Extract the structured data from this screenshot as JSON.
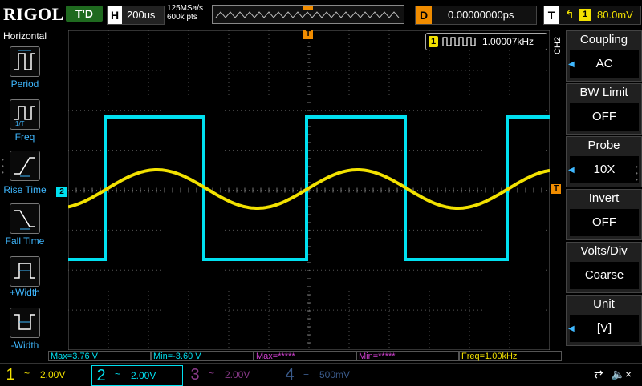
{
  "top": {
    "brand": "RIGOL",
    "run_status": "T'D",
    "timebase_tag": "H",
    "timebase": "200us",
    "sample_rate": "125MSa/s",
    "mem_depth": "600k pts",
    "delay_tag": "D",
    "delay": "0.00000000ps",
    "trigger_tag": "T",
    "trigger_channel": "1",
    "trigger_level": "80.0mV"
  },
  "left_menu": {
    "title": "Horizontal",
    "items": [
      {
        "label": "Period",
        "icon": "period-icon"
      },
      {
        "label": "Freq",
        "icon": "freq-icon"
      },
      {
        "label": "Rise Time",
        "icon": "rise-time-icon"
      },
      {
        "label": "Fall Time",
        "icon": "fall-time-icon"
      },
      {
        "label": "+Width",
        "icon": "pos-width-icon"
      },
      {
        "label": "-Width",
        "icon": "neg-width-icon"
      }
    ]
  },
  "screen": {
    "freq_counter_channel": "1",
    "freq_counter": "1.00007kHz",
    "ch2_marker": "2",
    "trig_marker": "T",
    "t_marker": "T"
  },
  "right_menu": {
    "channel_label": "CH2",
    "items": [
      {
        "title": "Coupling",
        "value": "AC",
        "arrow": true
      },
      {
        "title": "BW Limit",
        "value": "OFF",
        "arrow": false
      },
      {
        "title": "Probe",
        "value": "10X",
        "arrow": true
      },
      {
        "title": "Invert",
        "value": "OFF",
        "arrow": false
      },
      {
        "title": "Volts/Div",
        "value": "Coarse",
        "arrow": false
      },
      {
        "title": "Unit",
        "value": "[V]",
        "arrow": true
      }
    ]
  },
  "measurements": [
    {
      "text": "Max=3.76 V",
      "color": "#00e0f0"
    },
    {
      "text": "Min=-3.60 V",
      "color": "#00e0f0"
    },
    {
      "text": "Max=*****",
      "color": "#d040d0"
    },
    {
      "text": "Min=*****",
      "color": "#d040d0"
    },
    {
      "text": "Freq=1.00kHz",
      "color": "#f2e100"
    }
  ],
  "channels": [
    {
      "num": "1",
      "coupling": "~",
      "scale": "2.00V",
      "color": "#f2e100",
      "active": false
    },
    {
      "num": "2",
      "coupling": "~",
      "scale": "2.00V",
      "color": "#00e0f0",
      "active": true
    },
    {
      "num": "3",
      "coupling": "~",
      "scale": "2.00V",
      "color": "#8a3a8a",
      "active": false
    },
    {
      "num": "4",
      "coupling": "=",
      "scale": "500mV",
      "color": "#3a5a8a",
      "active": false
    }
  ],
  "colors": {
    "ch1": "#f2e100",
    "ch2": "#00e0f0",
    "accent": "#f08c00",
    "menu_label": "#3fb8ff"
  }
}
